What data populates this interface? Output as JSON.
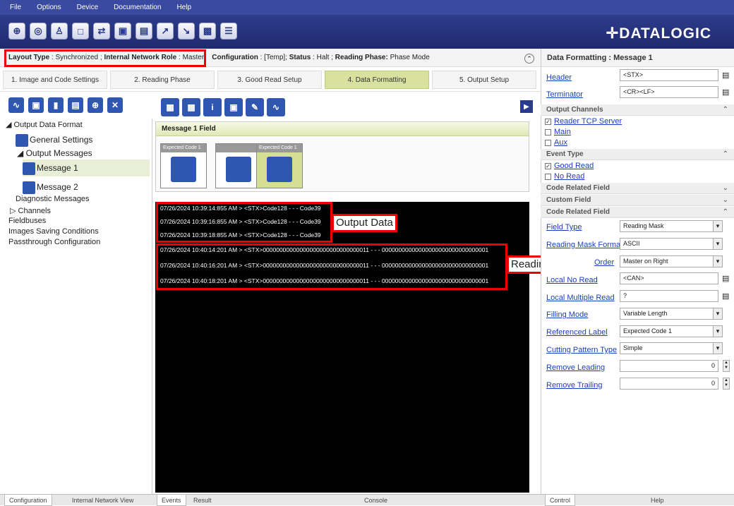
{
  "menu": [
    "File",
    "Options",
    "Device",
    "Documentation",
    "Help"
  ],
  "brand": "DATALOGIC",
  "status": {
    "layout_type_label": "Layout Type",
    "layout_type_value": "Synchronized",
    "role_label": "Internal Network Role",
    "role_value": "Master",
    "config_label": "Configuration",
    "config_value": "[Temp]",
    "status_label": "Status",
    "status_value": "Halt",
    "phase_label": "Reading Phase:",
    "phase_value": "Phase Mode"
  },
  "steps": [
    "1. Image and Code Settings",
    "2. Reading Phase",
    "3. Good Read Setup",
    "4. Data Formatting",
    "5. Output Setup"
  ],
  "tree": {
    "output_data_format": "Output Data Format",
    "general_settings": "General Settings",
    "output_messages": "Output Messages",
    "message1": "Message 1",
    "message2": "Message 2",
    "diagnostic": "Diagnostic Messages",
    "channels": "Channels",
    "fieldbuses": "Fieldbuses",
    "images_saving": "Images Saving Conditions",
    "passthrough": "Passthrough Configuration"
  },
  "message_field": {
    "header": "Message 1 Field",
    "tile1": "Expected Code 1",
    "tile3": "Expected Code 1"
  },
  "console_lines": [
    "07/26/2024 10:39:14:855 AM > <STX>Code128 - - - Code39",
    "07/26/2024 10:39:16:855 AM > <STX>Code128 - - - Code39",
    "07/26/2024 10:39:18:855 AM > <STX>Code128 - - - Code39",
    "07/26/2024 10:40:14:201 AM > <STX>00000000000000000000000000000011 - - - 00000000000000000000000000000001",
    "07/26/2024 10:40:16:201 AM > <STX>00000000000000000000000000000011 - - - 00000000000000000000000000000001",
    "07/26/2024 10:40:18:201 AM > <STX>00000000000000000000000000000011 - - - 00000000000000000000000000000001"
  ],
  "annotations": {
    "output_data": "Output Data",
    "reading_mask": "Reading Mask"
  },
  "right": {
    "title": "Data Formatting : Message 1",
    "header_label": "Header",
    "header_value": "<STX>",
    "terminator_label": "Terminator",
    "terminator_value": "<CR><LF>",
    "output_channels": "Output Channels",
    "ch_reader": "Reader TCP Server",
    "ch_main": "Main",
    "ch_aux": "Aux",
    "event_type": "Event Type",
    "ev_good": "Good Read",
    "ev_no": "No Read",
    "code_related_1": "Code Related Field",
    "custom_field": "Custom Field",
    "code_related_2": "Code Related Field",
    "field_type_label": "Field Type",
    "field_type_value": "Reading Mask",
    "mask_format_label": "Reading Mask Format",
    "mask_format_value": "ASCII",
    "order_label": "Order",
    "order_value": "Master on Right",
    "local_noread_label": "Local No Read",
    "local_noread_value": "<CAN>",
    "local_multi_label": "Local Multiple Read",
    "local_multi_value": "?",
    "filling_label": "Filling Mode",
    "filling_value": "Variable Length",
    "ref_label": "Referenced Label",
    "ref_value": "Expected Code  1",
    "cutting_label": "Cutting Pattern Type",
    "cutting_value": "Simple",
    "remove_leading_label": "Remove Leading",
    "remove_leading_value": "0",
    "remove_trailing_label": "Remove Trailing",
    "remove_trailing_value": "0"
  },
  "bottom_tabs": {
    "configuration": "Configuration",
    "internal_network": "Internal Network View",
    "events": "Events",
    "result": "Result",
    "console": "Console",
    "control": "Control",
    "help": "Help"
  }
}
